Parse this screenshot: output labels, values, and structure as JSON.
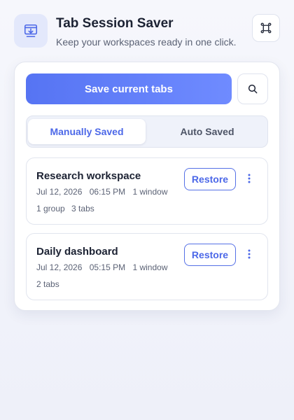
{
  "header": {
    "title": "Tab Session Saver",
    "subtitle": "Keep your workspaces ready in one click.",
    "logo_icon": "tab-download-icon",
    "settings_icon": "extension-settings-icon"
  },
  "toolbar": {
    "save_label": "Save current tabs",
    "search_icon": "search-icon"
  },
  "tabs": [
    {
      "label": "Manually Saved",
      "active": true
    },
    {
      "label": "Auto Saved",
      "active": false
    }
  ],
  "sessions": [
    {
      "name": "Research workspace",
      "date": "Jul 12, 2026",
      "time": "06:15 PM",
      "windows": "1 window",
      "groups": "1 group",
      "tabs": "3 tabs",
      "restore_label": "Restore"
    },
    {
      "name": "Daily dashboard",
      "date": "Jul 12, 2026",
      "time": "05:15 PM",
      "windows": "1 window",
      "tabs": "2 tabs",
      "restore_label": "Restore"
    }
  ],
  "colors": {
    "accent": "#5674f3",
    "accent_text": "#4c68e8",
    "background": "#eef0f9"
  }
}
